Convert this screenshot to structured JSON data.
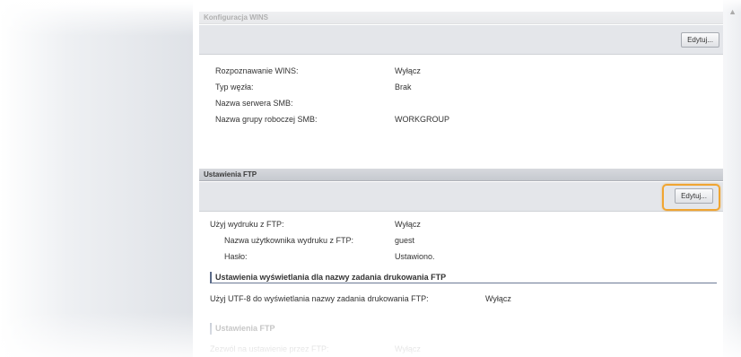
{
  "wins": {
    "header": "Konfiguracja WINS",
    "edit_label": "Edytuj...",
    "rows": [
      {
        "label": "Rozpoznawanie WINS:",
        "value": "Wyłącz"
      },
      {
        "label": "Typ węzła:",
        "value": "Brak"
      },
      {
        "label": "Nazwa serwera SMB:",
        "value": ""
      },
      {
        "label": "Nazwa grupy roboczej SMB:",
        "value": "WORKGROUP"
      }
    ]
  },
  "ftp": {
    "header": "Ustawienia FTP",
    "edit_label": "Edytuj...",
    "rows": [
      {
        "label": "Użyj wydruku z FTP:",
        "value": "Wyłącz"
      },
      {
        "label": "Nazwa użytkownika wydruku z FTP:",
        "value": "guest"
      },
      {
        "label": "Hasło:",
        "value": "Ustawiono."
      }
    ]
  },
  "job_name": {
    "header": "Ustawienia wyświetlania dla nazwy zadania drukowania FTP",
    "label": "Użyj UTF-8 do wyświetlania nazwy zadania drukowania FTP:",
    "value": "Wyłącz"
  },
  "ftp2": {
    "header": "Ustawienia FTP",
    "label": "Zezwól na ustawienie przez FTP:",
    "value": "Wyłącz"
  },
  "colors": {
    "highlight": "#f0a531",
    "section_header": "#c6c9cf",
    "toolbar": "#e4e6ea"
  }
}
